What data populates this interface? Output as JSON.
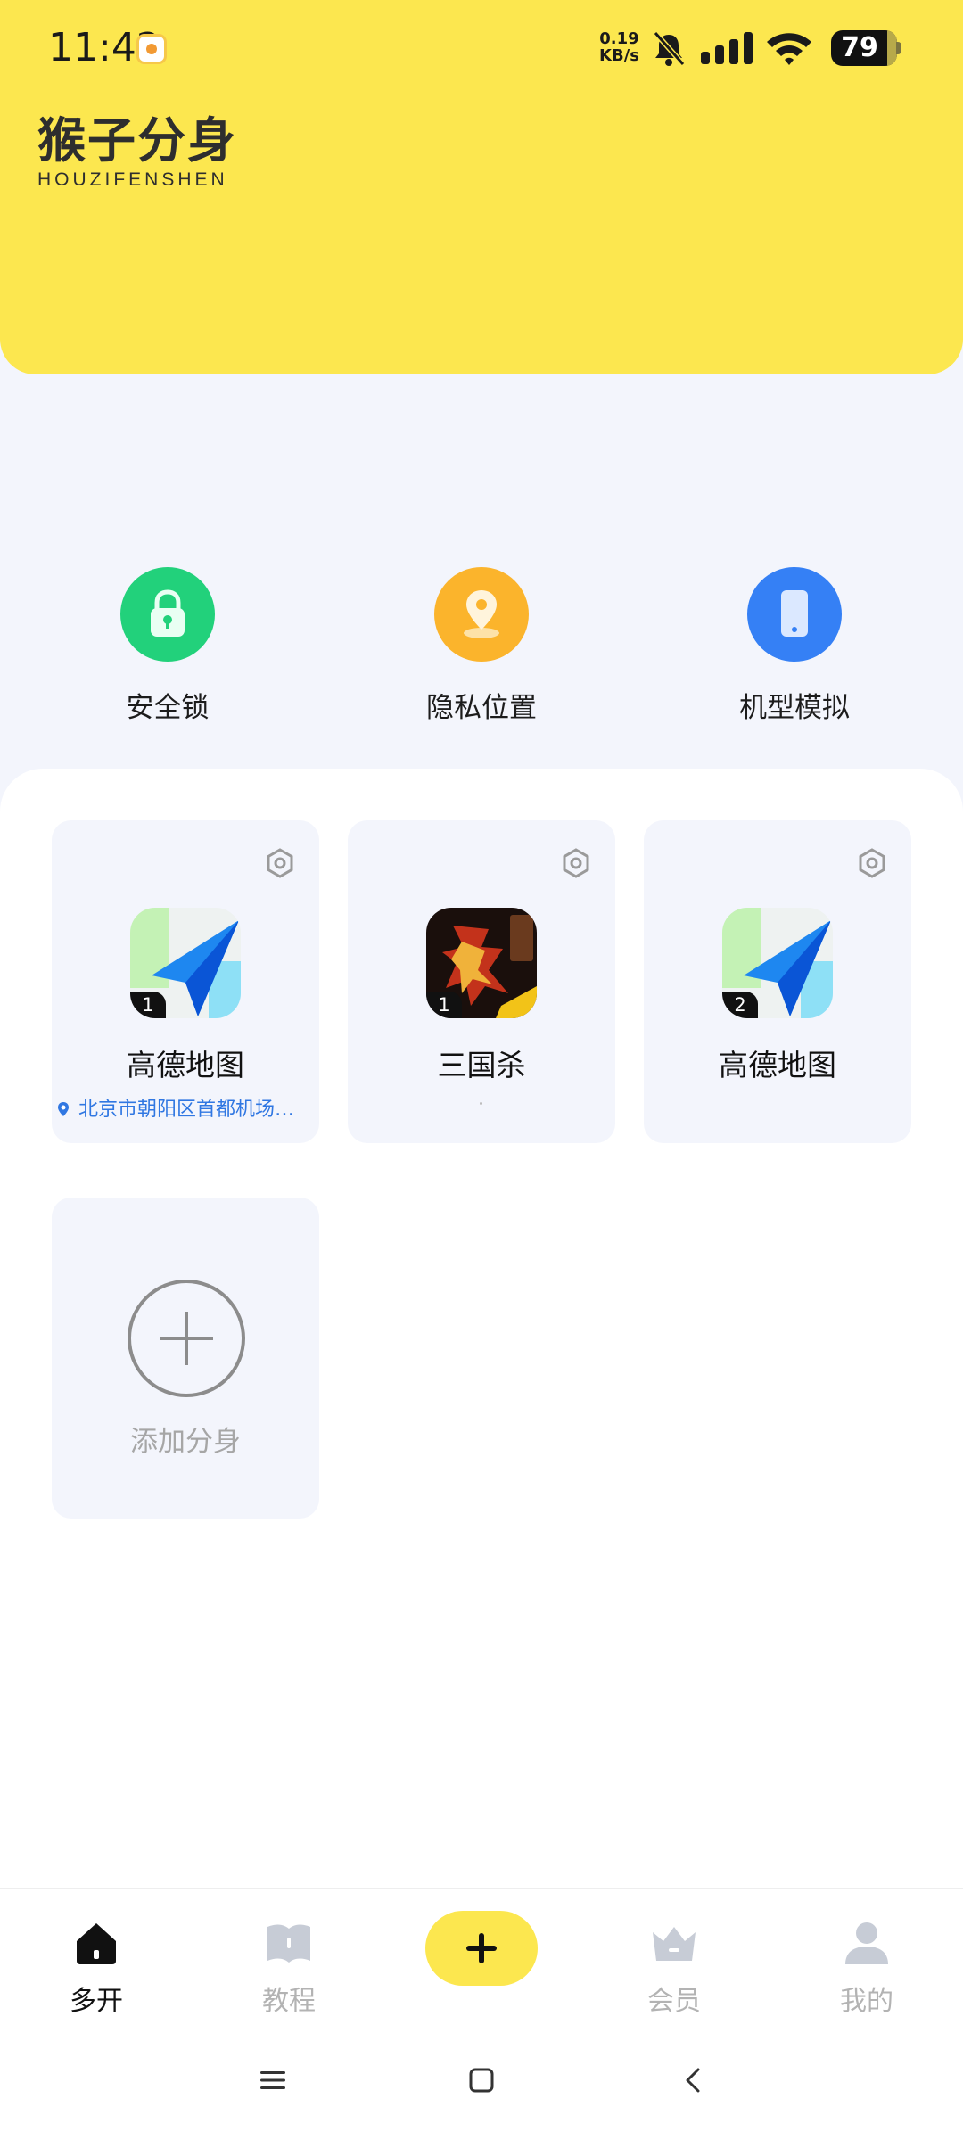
{
  "status_bar": {
    "time": "11:42",
    "net_speed_value": "0.19",
    "net_speed_unit": "KB/s",
    "battery_level": "79"
  },
  "header": {
    "logo_main": "猴子分身",
    "logo_sub": "HOUZIFENSHEN",
    "background_color": "#fce74f"
  },
  "features": [
    {
      "label": "安全锁",
      "icon": "lock-icon",
      "color": "#22d17b"
    },
    {
      "label": "隐私位置",
      "icon": "location-pin-icon",
      "color": "#fbb42c"
    },
    {
      "label": "机型模拟",
      "icon": "phone-icon",
      "color": "#3580f5"
    }
  ],
  "apps": [
    {
      "title": "高德地图",
      "badge": "1",
      "location": "北京市朝阳区首都机场…",
      "icon": "amap-icon",
      "settings_icon": "gear-icon"
    },
    {
      "title": "三国杀",
      "badge": "1",
      "location": "",
      "icon": "sanguosha-icon",
      "settings_icon": "gear-icon"
    },
    {
      "title": "高德地图",
      "badge": "2",
      "location": "",
      "icon": "amap-icon",
      "settings_icon": "gear-icon"
    }
  ],
  "add_clone": {
    "label": "添加分身",
    "icon": "plus-circle-icon"
  },
  "bottom_nav": {
    "items": [
      {
        "label": "多开",
        "icon": "home-icon",
        "active": true
      },
      {
        "label": "教程",
        "icon": "book-icon",
        "active": false
      },
      {
        "label": "会员",
        "icon": "crown-icon",
        "active": false
      },
      {
        "label": "我的",
        "icon": "person-icon",
        "active": false
      }
    ],
    "fab_icon": "plus-icon"
  },
  "system_nav": {
    "icons": [
      "menu-icon",
      "home-square-icon",
      "back-icon"
    ]
  }
}
